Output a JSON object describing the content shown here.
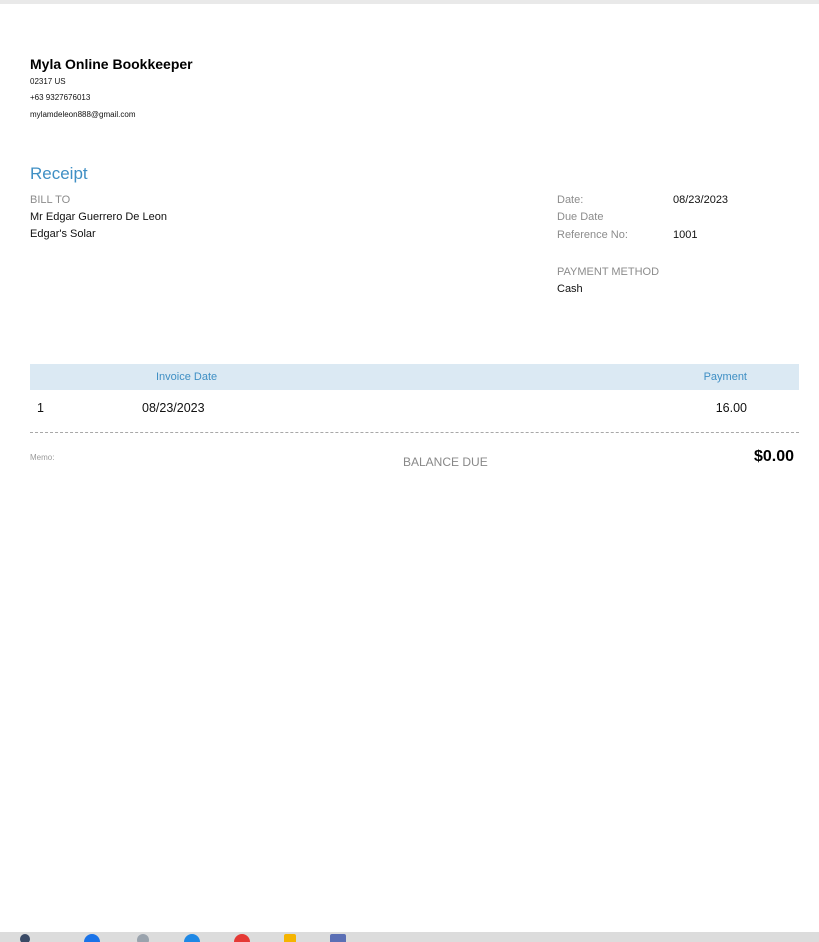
{
  "company": {
    "name": "Myla Online Bookkeeper",
    "postal": "02317 US",
    "phone": "+63 9327676013",
    "email": "mylamdeleon888@gmail.com"
  },
  "document": {
    "title": "Receipt"
  },
  "bill_to": {
    "label": "BILL TO",
    "name": "Mr Edgar Guerrero De Leon",
    "company": "Edgar's Solar"
  },
  "meta": {
    "date_label": "Date:",
    "date_value": "08/23/2023",
    "due_date_label": "Due Date",
    "reference_label": "Reference No:",
    "reference_value": "1001"
  },
  "payment": {
    "method_label": "PAYMENT METHOD",
    "method_value": "Cash"
  },
  "table": {
    "headers": {
      "number": "",
      "invoice_date": "Invoice Date",
      "payment": "Payment"
    },
    "rows": [
      {
        "number": "1",
        "invoice_date": "08/23/2023",
        "payment": "16.00"
      }
    ]
  },
  "footer": {
    "memo_label": "Memo:",
    "balance_due_label": "BALANCE DUE",
    "balance_due_value": "$0.00"
  },
  "colors": {
    "accent": "#3f8fc4",
    "header_bg": "#dbe9f3",
    "label_grey": "#8c8c8c"
  },
  "taskbar": {
    "icons": [
      "app-icon",
      "chrome-icon",
      "settings-icon",
      "browser-icon",
      "app-red-icon",
      "folder-icon",
      "app-blue-icon"
    ]
  }
}
